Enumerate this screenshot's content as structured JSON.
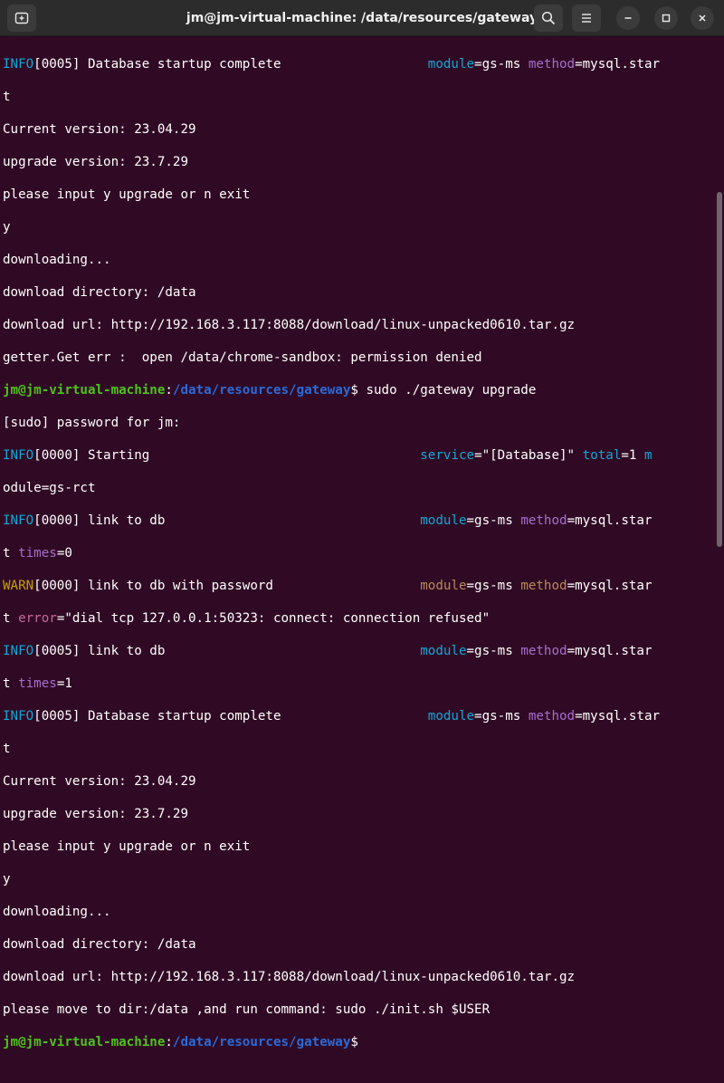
{
  "window": {
    "title": "jm@jm-virtual-machine: /data/resources/gateway",
    "new_tab_icon": "new-tab-icon",
    "search_icon": "search-icon",
    "menu_icon": "hamburger-menu-icon",
    "minimize_icon": "minimize-icon",
    "maximize_icon": "maximize-icon",
    "close_icon": "close-icon"
  },
  "colors": {
    "background": "#300a24",
    "info": "#12a7d6",
    "warn": "#c4a000",
    "prompt_user": "#4ec31a",
    "prompt_path": "#2a6ad8"
  },
  "terminal": {
    "l1a": "INFO",
    "l1b": "[0005] Database startup complete                   ",
    "l1c": "module",
    "l1d": "=gs-ms ",
    "l1e": "method",
    "l1f": "=mysql.star",
    "l2": "t",
    "l3": "Current version: 23.04.29",
    "l4": "upgrade version: 23.7.29",
    "l5": "please input y upgrade or n exit",
    "l6": "y",
    "l7": "downloading...",
    "l8": "download directory: /data",
    "l9": "download url: http://192.168.3.117:8088/download/linux-unpacked0610.tar.gz",
    "l10": "getter.Get err :  open /data/chrome-sandbox: permission denied",
    "p1_user": "jm@jm-virtual-machine",
    "p1_sep": ":",
    "p1_path": "/data/resources/gateway",
    "p1_cmd": "$ sudo ./gateway upgrade",
    "l12": "[sudo] password for jm:",
    "l13a": "INFO",
    "l13b": "[0000] Starting                                   ",
    "l13c": "service",
    "l13d": "=\"[Database]\" ",
    "l13e": "total",
    "l13f": "=1 ",
    "l13g": "m",
    "l14": "odule=gs-rct",
    "l15a": "INFO",
    "l15b": "[0000] link to db                                 ",
    "l15c": "module",
    "l15d": "=gs-ms ",
    "l15e": "method",
    "l15f": "=mysql.star",
    "l16a": "t ",
    "l16b": "times",
    "l16c": "=0",
    "l17a": "WARN",
    "l17b": "[0000] link to db with password                   ",
    "l17c": "module",
    "l17d": "=gs-ms ",
    "l17e": "method",
    "l17f": "=mysql.star",
    "l18a": "t ",
    "l18b": "error",
    "l18c": "=\"dial tcp 127.0.0.1:50323: connect: connection refused\"",
    "l19a": "INFO",
    "l19b": "[0005] link to db                                 ",
    "l19c": "module",
    "l19d": "=gs-ms ",
    "l19e": "method",
    "l19f": "=mysql.star",
    "l20a": "t ",
    "l20b": "times",
    "l20c": "=1",
    "l21a": "INFO",
    "l21b": "[0005] Database startup complete                   ",
    "l21c": "module",
    "l21d": "=gs-ms ",
    "l21e": "method",
    "l21f": "=mysql.star",
    "l22": "t",
    "l23": "Current version: 23.04.29",
    "l24": "upgrade version: 23.7.29",
    "l25": "please input y upgrade or n exit",
    "l26": "y",
    "l27": "downloading...",
    "l28": "download directory: /data",
    "l29": "download url: http://192.168.3.117:8088/download/linux-unpacked0610.tar.gz",
    "l30": "please move to dir:/data ,and run command: sudo ./init.sh $USER",
    "p2_user": "jm@jm-virtual-machine",
    "p2_sep": ":",
    "p2_path": "/data/resources/gateway",
    "p2_cmd": "$"
  }
}
